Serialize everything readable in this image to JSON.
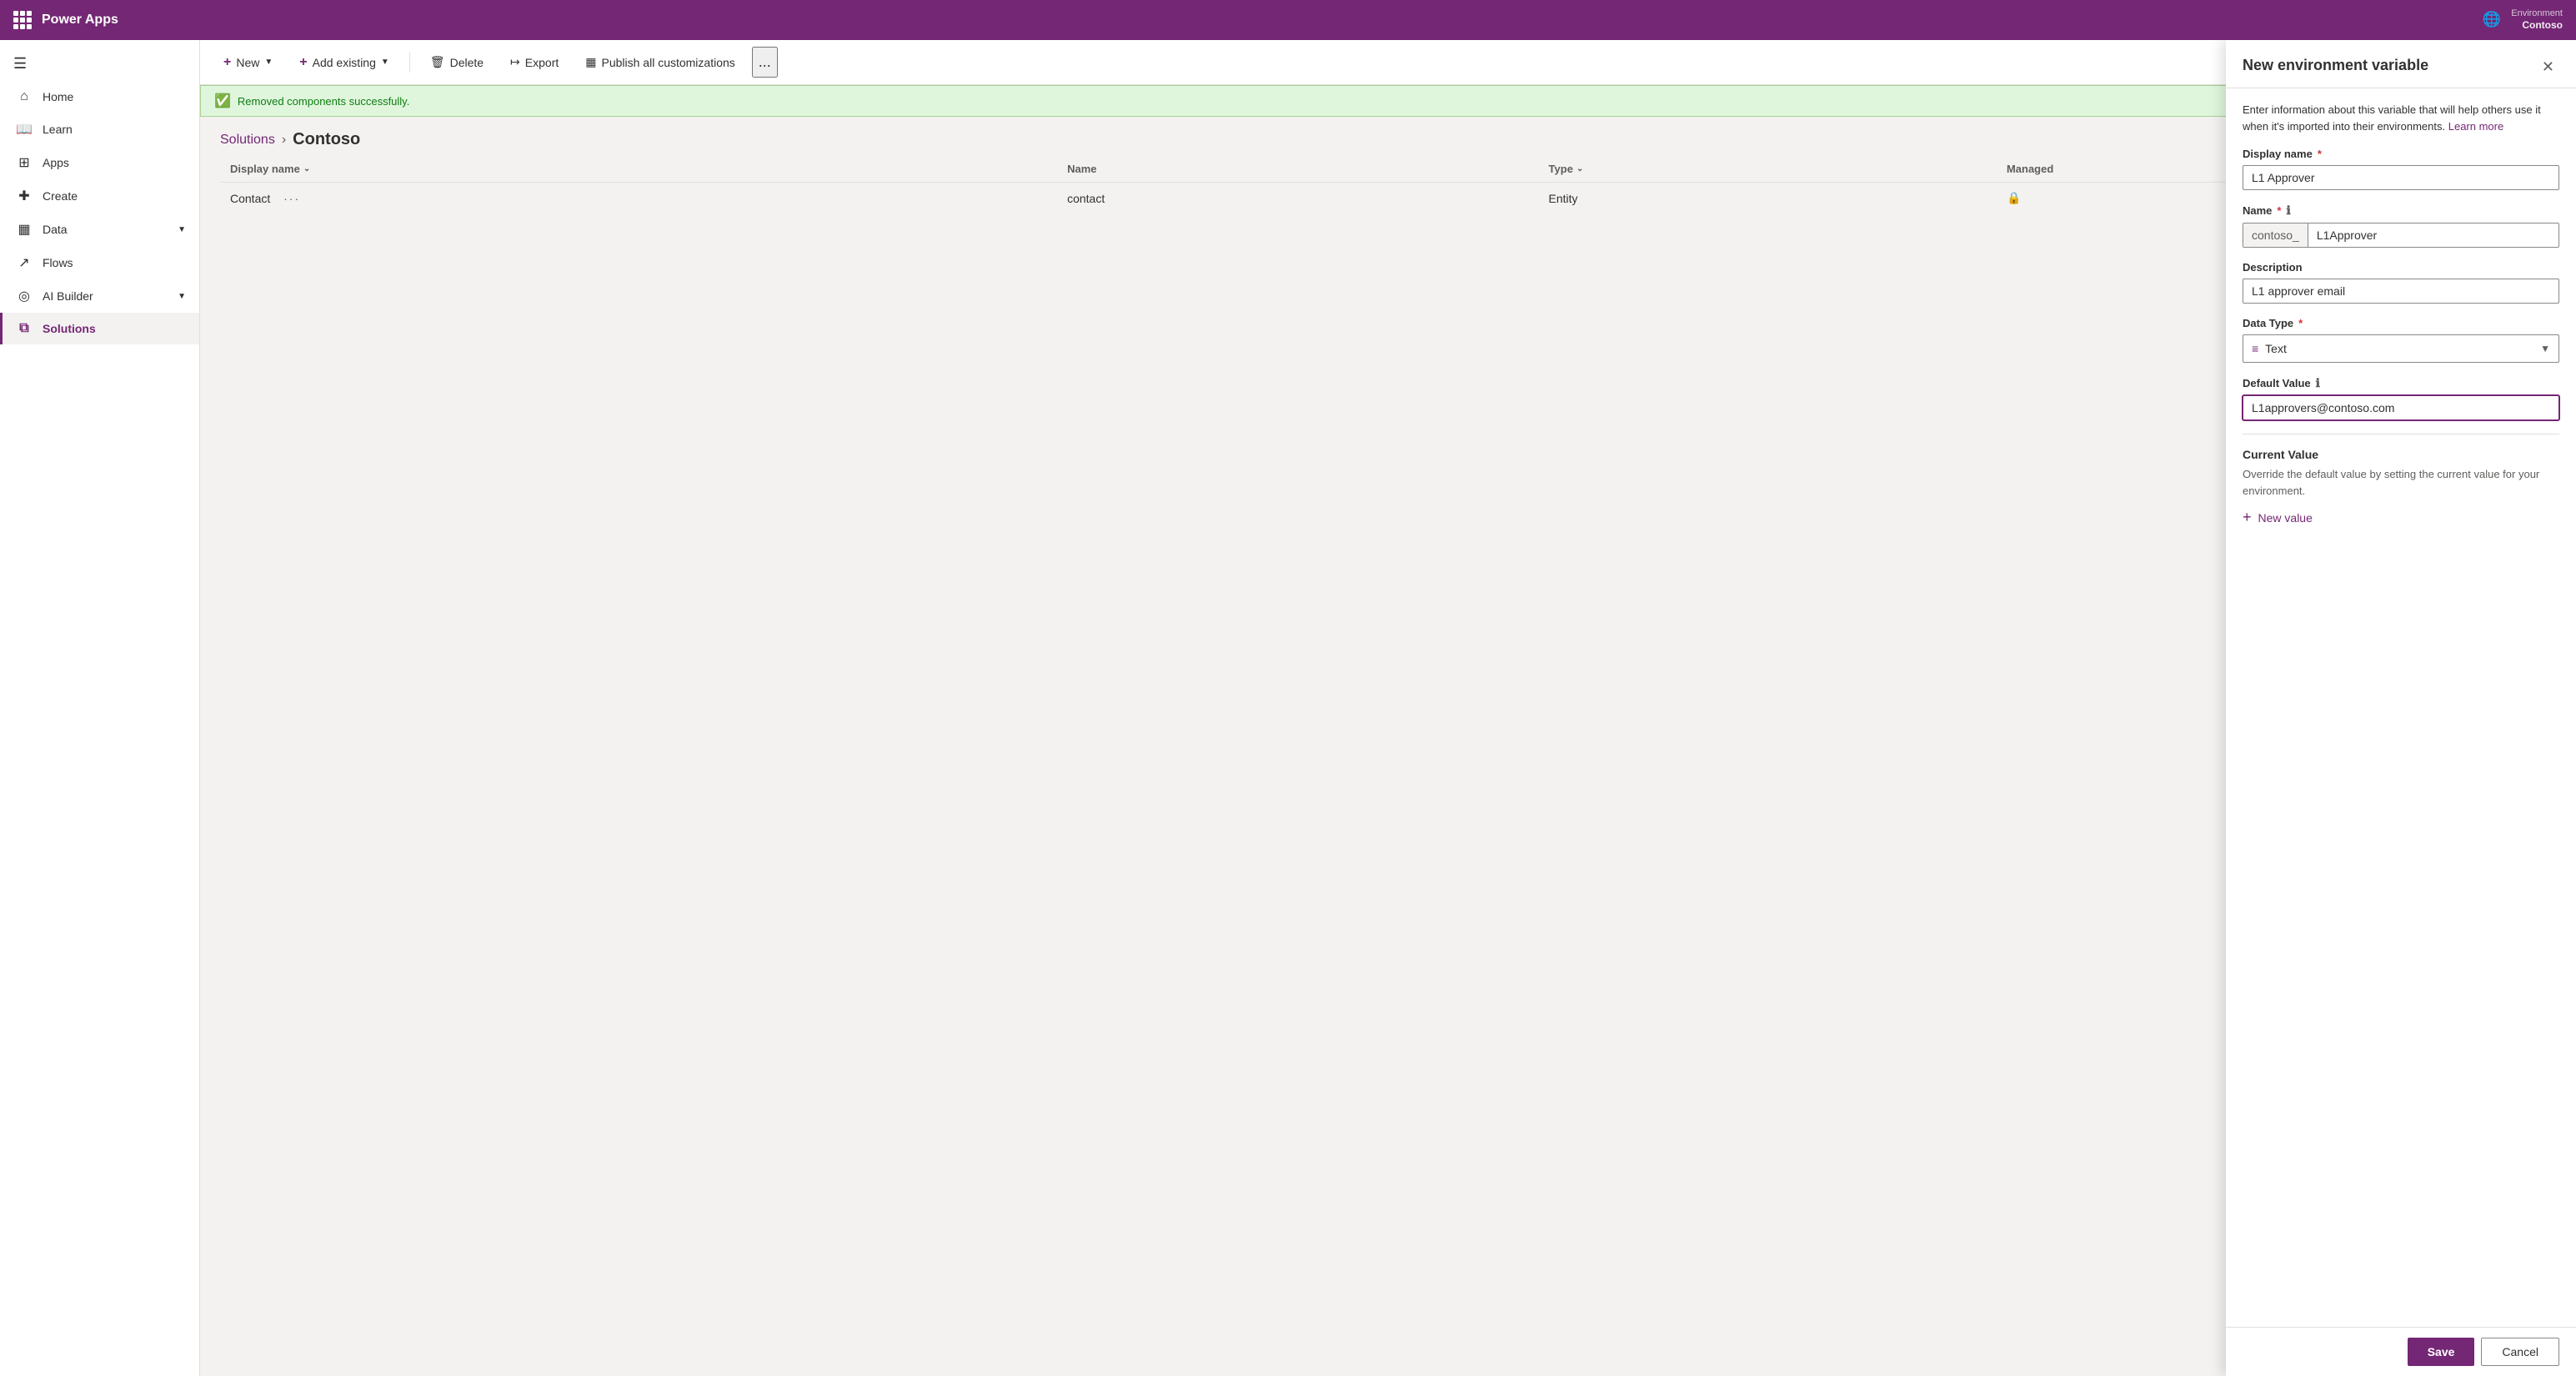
{
  "topbar": {
    "title": "Power Apps",
    "env_label": "Environment",
    "env_name": "Contoso"
  },
  "sidebar": {
    "hamburger_label": "☰",
    "items": [
      {
        "id": "home",
        "label": "Home",
        "icon": "⌂",
        "active": false
      },
      {
        "id": "learn",
        "label": "Learn",
        "icon": "□",
        "active": false
      },
      {
        "id": "apps",
        "label": "Apps",
        "icon": "⊞",
        "active": false
      },
      {
        "id": "create",
        "label": "Create",
        "icon": "+",
        "active": false
      },
      {
        "id": "data",
        "label": "Data",
        "icon": "⊟",
        "active": false,
        "has_chevron": true
      },
      {
        "id": "flows",
        "label": "Flows",
        "icon": "↗",
        "active": false
      },
      {
        "id": "ai-builder",
        "label": "AI Builder",
        "icon": "◎",
        "active": false,
        "has_chevron": true
      },
      {
        "id": "solutions",
        "label": "Solutions",
        "icon": "⧉",
        "active": true
      }
    ]
  },
  "toolbar": {
    "new_label": "New",
    "add_existing_label": "Add existing",
    "delete_label": "Delete",
    "export_label": "Export",
    "publish_label": "Publish all customizations",
    "more_label": "..."
  },
  "success_banner": {
    "message": "Removed components successfully."
  },
  "breadcrumb": {
    "parent": "Solutions",
    "current": "Contoso"
  },
  "table": {
    "columns": [
      {
        "id": "display-name",
        "label": "Display name",
        "sortable": true
      },
      {
        "id": "name",
        "label": "Name",
        "sortable": false
      },
      {
        "id": "type",
        "label": "Type",
        "sortable": true
      },
      {
        "id": "managed",
        "label": "Managed",
        "sortable": false
      }
    ],
    "rows": [
      {
        "display_name": "Contact",
        "actions": "···",
        "name": "contact",
        "type": "Entity",
        "managed": true,
        "lock": true
      }
    ]
  },
  "panel": {
    "title": "New environment variable",
    "description": "Enter information about this variable that will help others use it when it's imported into their environments.",
    "learn_more_label": "Learn more",
    "display_name_label": "Display name",
    "display_name_required": "*",
    "display_name_value": "L1 Approver",
    "name_label": "Name",
    "name_required": "*",
    "name_prefix": "contoso_",
    "name_suffix": "L1Approver",
    "description_label": "Description",
    "description_value": "L1 approver email",
    "data_type_label": "Data Type",
    "data_type_required": "*",
    "data_type_icon": "≡",
    "data_type_value": "Text",
    "default_value_label": "Default Value",
    "default_value": "L1approvers@contoso.com",
    "current_value_title": "Current Value",
    "current_value_desc": "Override the default value by setting the current value for your environment.",
    "new_value_label": "New value",
    "save_label": "Save",
    "cancel_label": "Cancel"
  }
}
